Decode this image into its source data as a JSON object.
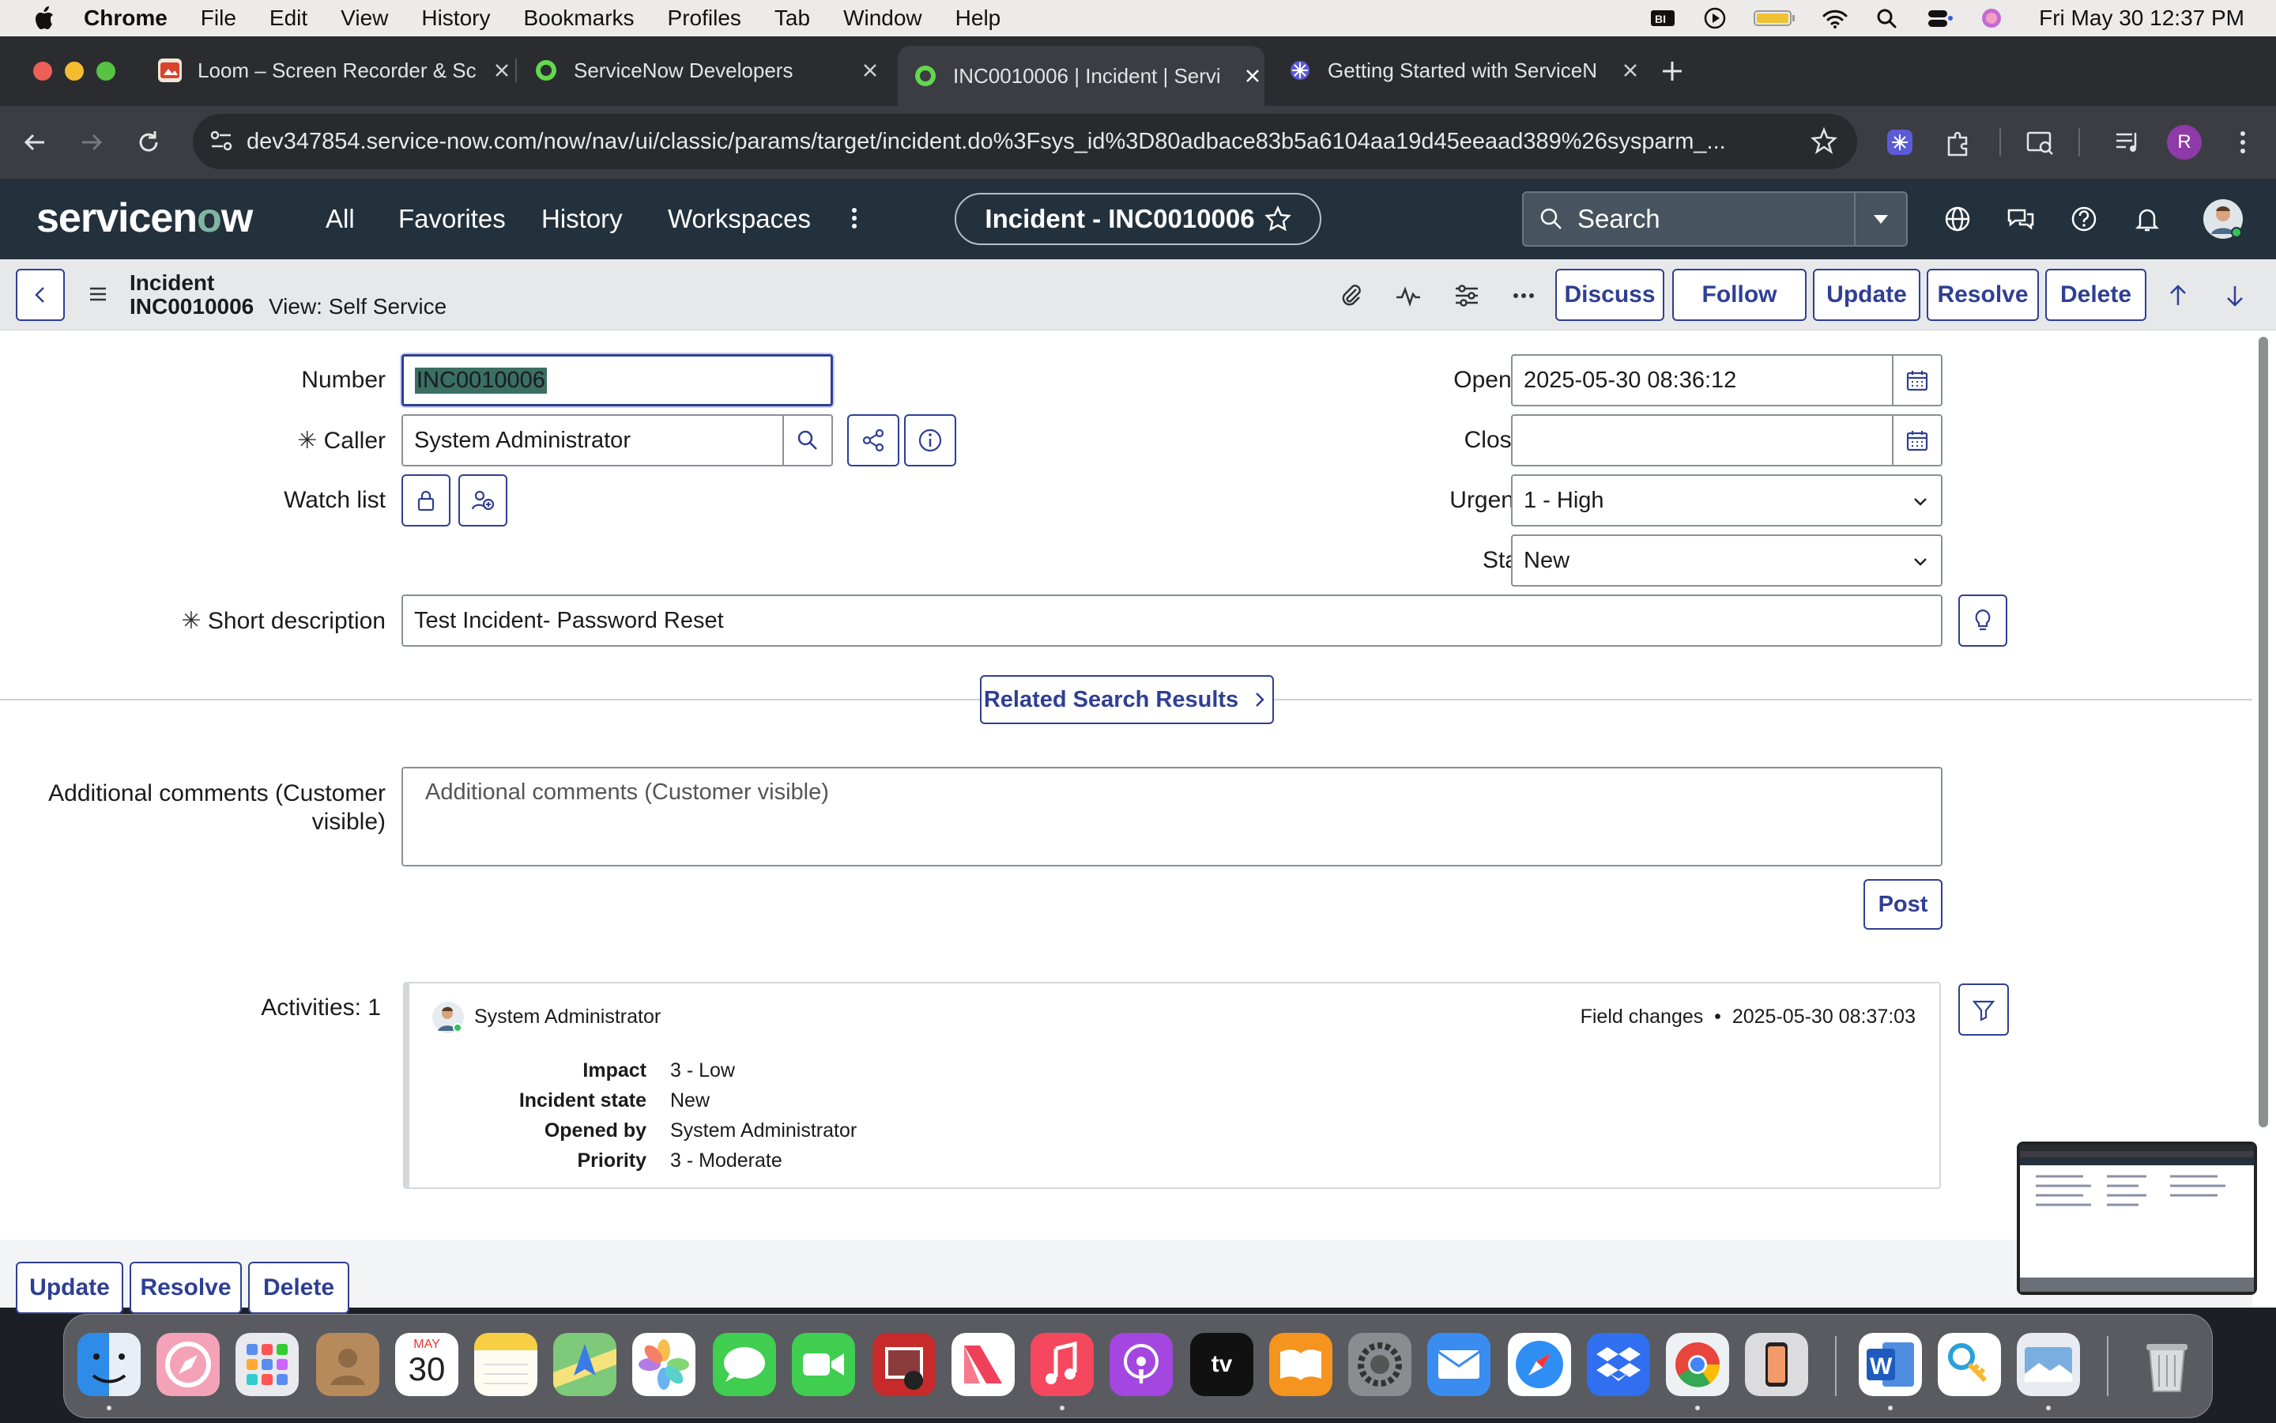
{
  "menubar": {
    "app": "Chrome",
    "items": [
      "File",
      "Edit",
      "View",
      "History",
      "Bookmarks",
      "Profiles",
      "Tab",
      "Window",
      "Help"
    ],
    "clock": "Fri May 30  12:37 PM"
  },
  "browser": {
    "tabs": [
      {
        "title": "Loom – Screen Recorder & Sc",
        "favicon": "loom-icon"
      },
      {
        "title": "ServiceNow Developers",
        "favicon": "servicenow-icon"
      },
      {
        "title": "INC0010006 | Incident | Servi",
        "favicon": "servicenow-icon"
      },
      {
        "title": "Getting Started with ServiceN",
        "favicon": "servicenow-ai-icon"
      }
    ],
    "url": "dev347854.service-now.com/now/nav/ui/classic/params/target/incident.do%3Fsys_id%3D80adbace83b5a6104aa19d45eeaad389%26sysparm_...",
    "profile_initial": "R"
  },
  "sn_header": {
    "logo_left": "servicen",
    "logo_o": "o",
    "logo_right": "w",
    "nav": [
      "All",
      "Favorites",
      "History",
      "Workspaces"
    ],
    "context_title": "Incident - INC0010006",
    "search_placeholder": "Search"
  },
  "form_header": {
    "table_label": "Incident",
    "record_number": "INC0010006",
    "view_label": "View: Self Service",
    "buttons": [
      "Discuss",
      "Follow",
      "Update",
      "Resolve",
      "Delete"
    ]
  },
  "form": {
    "number": {
      "label": "Number",
      "value": "INC0010006"
    },
    "caller": {
      "label": "Caller",
      "value": "System Administrator"
    },
    "watch_list": {
      "label": "Watch list"
    },
    "opened": {
      "label": "Opened",
      "value": "2025-05-30 08:36:12"
    },
    "closed": {
      "label": "Closed",
      "value": ""
    },
    "urgency": {
      "label": "Urgency",
      "value": "1 - High"
    },
    "state": {
      "label": "State",
      "value": "New"
    },
    "short_description": {
      "label": "Short description",
      "value": "Test Incident- Password Reset"
    },
    "related_search": "Related Search Results",
    "comments": {
      "label_line1": "Additional comments (Customer",
      "label_line2": "visible)",
      "placeholder": "Additional comments (Customer visible)"
    },
    "post_button": "Post",
    "required_mark": "✳"
  },
  "activities": {
    "label": "Activities: 1",
    "author": "System Administrator",
    "type": "Field changes",
    "bullet": "•",
    "timestamp": "2025-05-30 08:37:03",
    "fields": [
      {
        "key": "Impact",
        "value": "3 - Low"
      },
      {
        "key": "Incident state",
        "value": "New"
      },
      {
        "key": "Opened by",
        "value": "System Administrator"
      },
      {
        "key": "Priority",
        "value": "3 - Moderate"
      }
    ]
  },
  "bottom_buttons": [
    "Update",
    "Resolve",
    "Delete"
  ],
  "dock": {
    "calendar_month": "MAY",
    "calendar_day": "30"
  },
  "colors": {
    "brand_blue": "#2f3f93",
    "header": "#23313c",
    "logo_accent": "#81b5a1"
  }
}
